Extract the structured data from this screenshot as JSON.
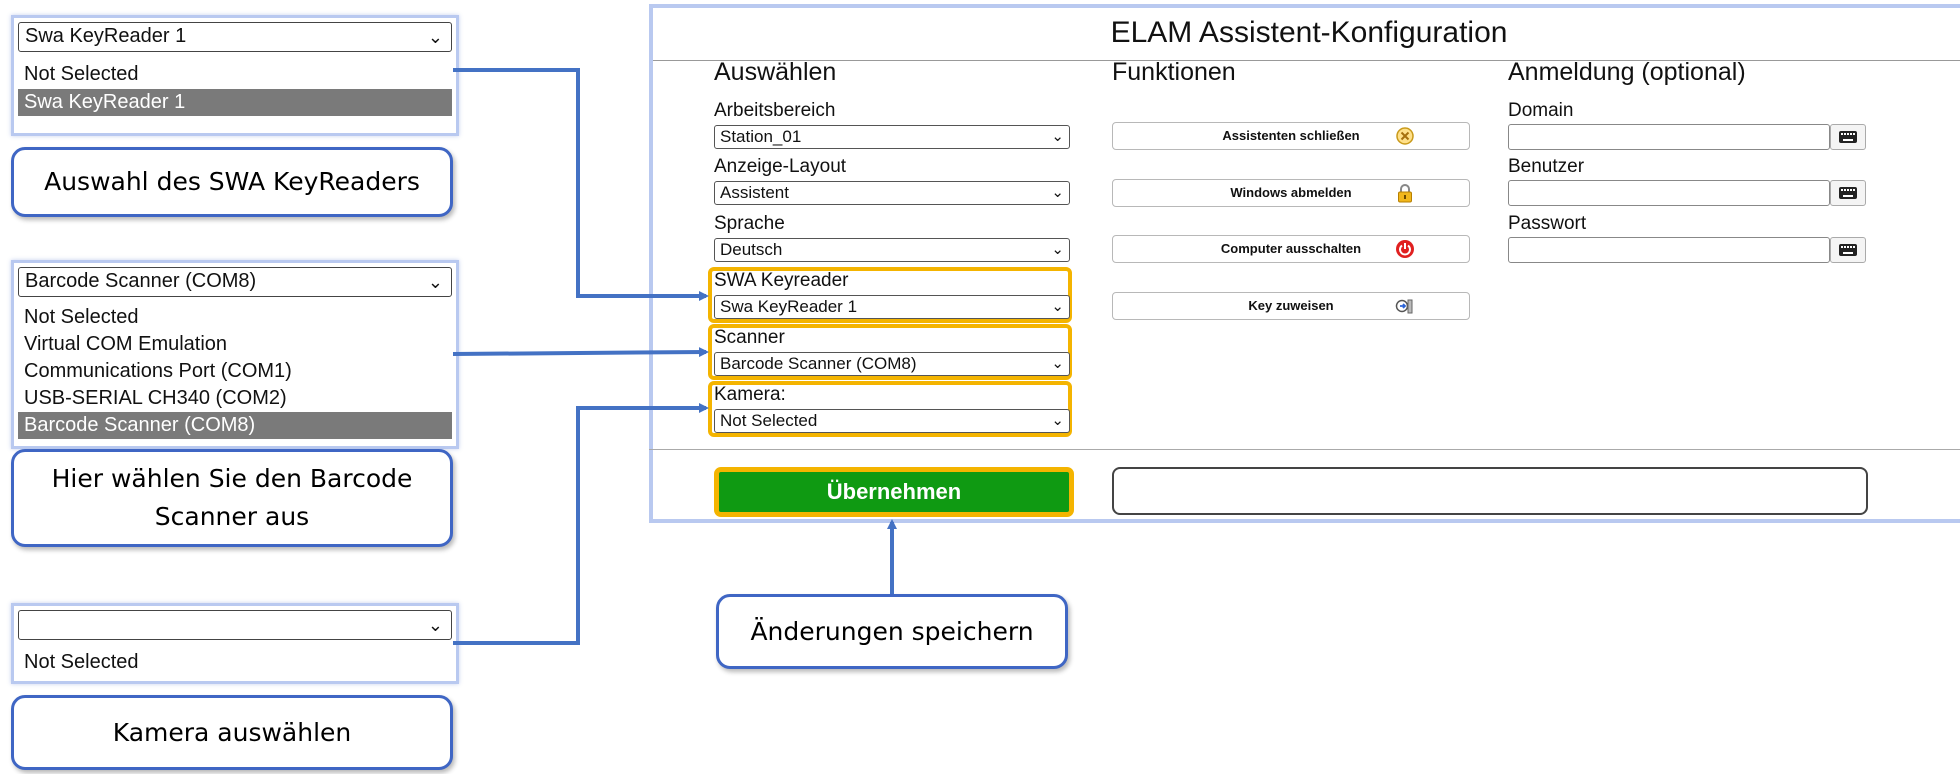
{
  "keyreader_panel": {
    "selected": "Swa KeyReader 1",
    "options": [
      "Not Selected",
      "Swa KeyReader 1"
    ],
    "callout": "Auswahl des SWA KeyReaders"
  },
  "scanner_panel": {
    "selected": "Barcode Scanner (COM8)",
    "options": [
      "Not Selected",
      "Virtual COM Emulation",
      "Communications Port (COM1)",
      "USB-SERIAL CH340 (COM2)",
      "Barcode Scanner (COM8)"
    ],
    "callout": "Hier wählen Sie den Barcode Scanner aus"
  },
  "camera_panel": {
    "selected": "",
    "options": [
      "Not Selected"
    ],
    "callout": "Kamera auswählen"
  },
  "save_callout": "Änderungen speichern",
  "window": {
    "title": "ELAM Assistent-Konfiguration",
    "col_select": {
      "heading": "Auswählen",
      "fields": [
        {
          "label": "Arbeitsbereich",
          "value": "Station_01"
        },
        {
          "label": "Anzeige-Layout",
          "value": "Assistent"
        },
        {
          "label": "Sprache",
          "value": "Deutsch"
        },
        {
          "label": "SWA Keyreader",
          "value": "Swa KeyReader 1"
        },
        {
          "label": "Scanner",
          "value": "Barcode Scanner (COM8)"
        },
        {
          "label": "Kamera:",
          "value": "Not Selected"
        }
      ]
    },
    "col_functions": {
      "heading": "Funktionen",
      "buttons": [
        {
          "label": "Assistenten schließen",
          "icon": "close-circle-icon"
        },
        {
          "label": "Windows abmelden",
          "icon": "padlock-icon"
        },
        {
          "label": "Computer ausschalten",
          "icon": "power-icon"
        },
        {
          "label": "Key zuweisen",
          "icon": "key-assign-icon"
        }
      ]
    },
    "col_login": {
      "heading": "Anmeldung (optional)",
      "fields": [
        {
          "label": "Domain",
          "value": ""
        },
        {
          "label": "Benutzer",
          "value": ""
        },
        {
          "label": "Passwort",
          "value": ""
        }
      ]
    },
    "apply_label": "Übernehmen",
    "status_text": ""
  },
  "colors": {
    "highlight": "#f4b400",
    "apply_green": "#0f9a12",
    "callout_border": "#3f66c4",
    "panel_glow": "#b9c9f0",
    "connector": "#4472c4"
  }
}
